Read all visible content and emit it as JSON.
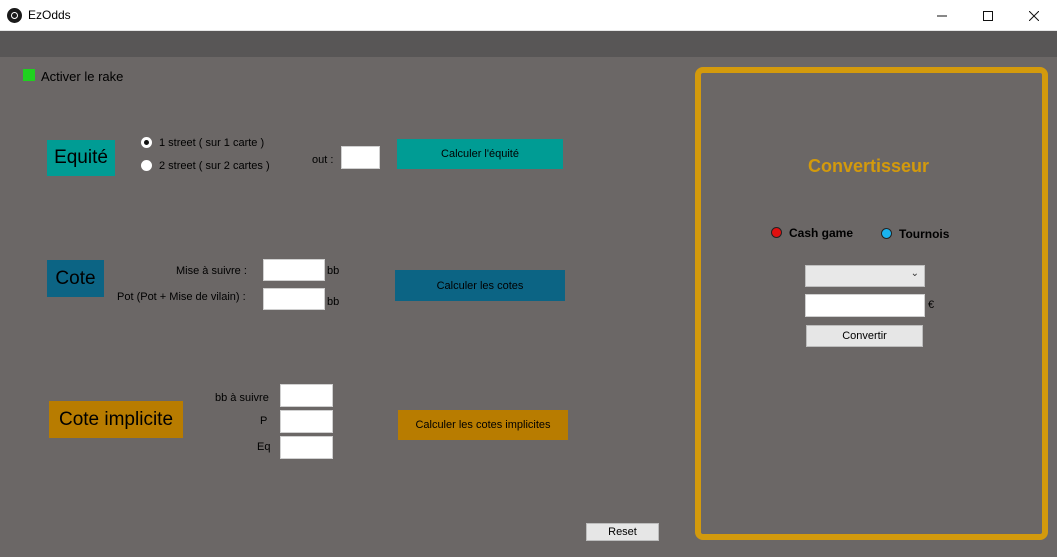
{
  "window": {
    "title": "EzOdds",
    "min_glyph": "—",
    "max_glyph": "☐",
    "close_glyph": "✕"
  },
  "rake": {
    "label": "Activer le rake",
    "color": "#1fd21f"
  },
  "equity": {
    "label": "Equité",
    "color": "#009c94",
    "radio1_label": "1 street ( sur 1 carte )",
    "radio1_checked": true,
    "radio2_label": "2 street ( sur 2 cartes )",
    "radio2_checked": false,
    "outs_label": "out :",
    "outs_value": "",
    "button_label": "Calculer l'équité"
  },
  "odds": {
    "label": "Cote",
    "color": "#0c6484",
    "bet_label": "Mise à suivre :",
    "bet_value": "",
    "bet_unit": "bb",
    "pot_label": "Pot (Pot + Mise de vilain) :",
    "pot_value": "",
    "pot_unit": "bb",
    "button_label": "Calculer les cotes"
  },
  "implied": {
    "label": "Cote implicite",
    "color": "#b87c00",
    "bb_label": "bb à suivre",
    "bb_value": "",
    "p_label": "P",
    "p_value": "",
    "eq_label": "Eq",
    "eq_value": "",
    "button_label": "Calculer les cotes implicites"
  },
  "reset_label": "Reset",
  "converter": {
    "title": "Convertisseur",
    "accent": "#d39a0c",
    "cash_label": "Cash game",
    "cash_color": "#e01010",
    "tournament_label": "Tournois",
    "tournament_color": "#1ab4f0",
    "select_value": "",
    "amount_value": "",
    "currency": "€",
    "button_label": "Convertir",
    "chevron_glyph": "⌄"
  }
}
